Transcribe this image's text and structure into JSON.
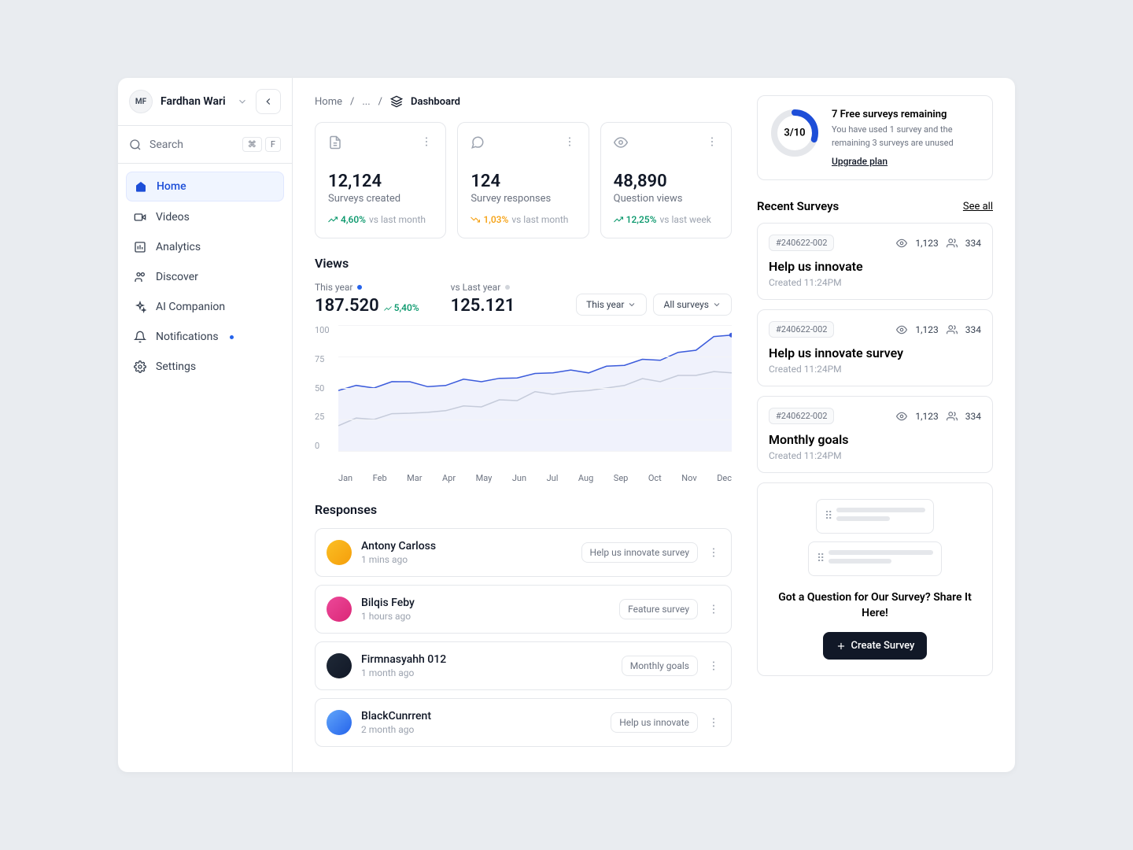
{
  "user": {
    "initials": "MF",
    "name": "Fardhan Wari"
  },
  "search": {
    "placeholder": "Search",
    "shortcut1": "⌘",
    "shortcut2": "F"
  },
  "nav": [
    {
      "label": "Home"
    },
    {
      "label": "Videos"
    },
    {
      "label": "Analytics"
    },
    {
      "label": "Discover"
    },
    {
      "label": "AI Companion"
    },
    {
      "label": "Notifications"
    },
    {
      "label": "Settings"
    }
  ],
  "breadcrumb": {
    "home": "Home",
    "dots": "...",
    "current": "Dashboard"
  },
  "stats": [
    {
      "value": "12,124",
      "label": "Surveys created",
      "pct": "4,60%",
      "vs": "vs last month",
      "dir": "up"
    },
    {
      "value": "124",
      "label": "Survey responses",
      "pct": "1,03%",
      "vs": "vs last month",
      "dir": "down"
    },
    {
      "value": "48,890",
      "label": "Question views",
      "pct": "12,25%",
      "vs": "vs last week",
      "dir": "up"
    }
  ],
  "views": {
    "title": "Views",
    "thisyear_lbl": "This year",
    "thisyear_val": "187.520",
    "thisyear_chg": "5,40%",
    "lastyear_lbl": "vs Last year",
    "lastyear_val": "125.121",
    "filter1": "This year",
    "filter2": "All surveys",
    "yticks": [
      "100",
      "75",
      "50",
      "25",
      "0"
    ],
    "xticks": [
      "Jan",
      "Feb",
      "Mar",
      "Apr",
      "May",
      "Jun",
      "Jul",
      "Aug",
      "Sep",
      "Oct",
      "Nov",
      "Dec"
    ]
  },
  "chart_data": {
    "type": "line",
    "categories": [
      "Jan",
      "Feb",
      "Mar",
      "Apr",
      "May",
      "Jun",
      "Jul",
      "Aug",
      "Sep",
      "Oct",
      "Nov",
      "Dec"
    ],
    "series": [
      {
        "name": "This year",
        "values": [
          48,
          50,
          55,
          52,
          55,
          58,
          62,
          62,
          68,
          72,
          80,
          92
        ]
      },
      {
        "name": "Last year",
        "values": [
          20,
          25,
          30,
          32,
          35,
          40,
          45,
          48,
          52,
          55,
          60,
          62
        ]
      }
    ],
    "ylim": [
      0,
      100
    ]
  },
  "responses": {
    "title": "Responses",
    "items": [
      {
        "name": "Antony Carloss",
        "time": "1 mins ago",
        "tag": "Help us innovate survey"
      },
      {
        "name": "Bilqis Feby",
        "time": "1 hours ago",
        "tag": "Feature survey"
      },
      {
        "name": "Firmnasyahh 012",
        "time": "1 month ago",
        "tag": "Monthly goals"
      },
      {
        "name": "BlackCunrrent",
        "time": "2 month ago",
        "tag": "Help us innovate"
      }
    ]
  },
  "quota": {
    "ratio": "3/10",
    "title": "7 Free surveys remaining",
    "desc": "You have used 1 survey and the remaining 3 surveys are unused",
    "link": "Upgrade plan"
  },
  "recent": {
    "title": "Recent Surveys",
    "seeall": "See all",
    "items": [
      {
        "id": "#240622-002",
        "views": "1,123",
        "resp": "334",
        "title": "Help us innovate",
        "time": "Created 11:24PM"
      },
      {
        "id": "#240622-002",
        "views": "1,123",
        "resp": "334",
        "title": "Help us innovate survey",
        "time": "Created 11:24PM"
      },
      {
        "id": "#240622-002",
        "views": "1,123",
        "resp": "334",
        "title": "Monthly goals",
        "time": "Created 11:24PM"
      }
    ]
  },
  "cta": {
    "text": "Got a Question for Our Survey? Share It Here!",
    "btn": "Create Survey"
  }
}
